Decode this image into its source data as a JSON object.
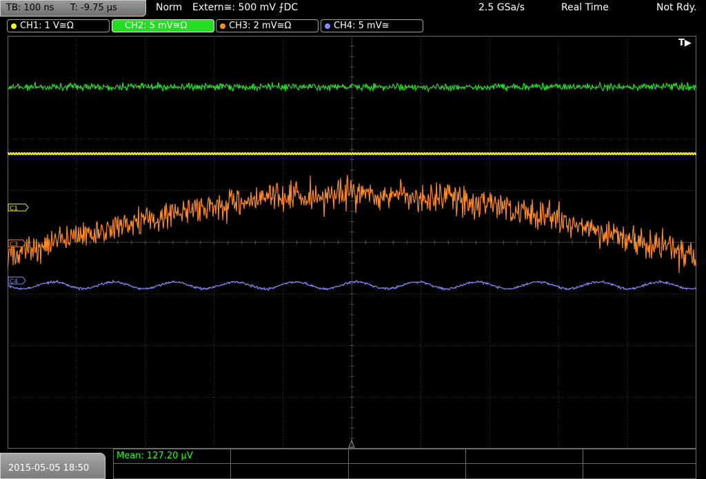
{
  "header": {
    "timebase": "TB: 100 ns",
    "trigger_offset": "T: -9.75 µs",
    "mode": "Norm",
    "trigger_source": "Extern≅: 500 mV ⨍DC",
    "sample_rate": "2.5 GSa/s",
    "acq_mode": "Real Time",
    "status": "Not Rdy."
  },
  "channels": [
    {
      "label": "CH1: 1 V≅Ω",
      "color": "#f5f51e",
      "active": false
    },
    {
      "label": "CH2: 5 mV≅Ω",
      "color": "#22dd22",
      "active": true
    },
    {
      "label": "CH3: 2 mV≅Ω",
      "color": "#ff8a24",
      "active": false
    },
    {
      "label": "CH4: 5 mV≅",
      "color": "#8a8aff",
      "active": false
    }
  ],
  "markers": {
    "trigger_label": "T▶",
    "c1": "C1",
    "c3": "C3",
    "c4": "C4"
  },
  "measurement": {
    "mean": "Mean: 127.20 µV"
  },
  "footer": {
    "datetime": "2015-05-05 18:50"
  },
  "colors": {
    "ch1": "#f5f51e",
    "ch2": "#22dd22",
    "ch3": "#ff8a24",
    "ch4": "#8a8aff",
    "grid": "#3a3a3a"
  }
}
